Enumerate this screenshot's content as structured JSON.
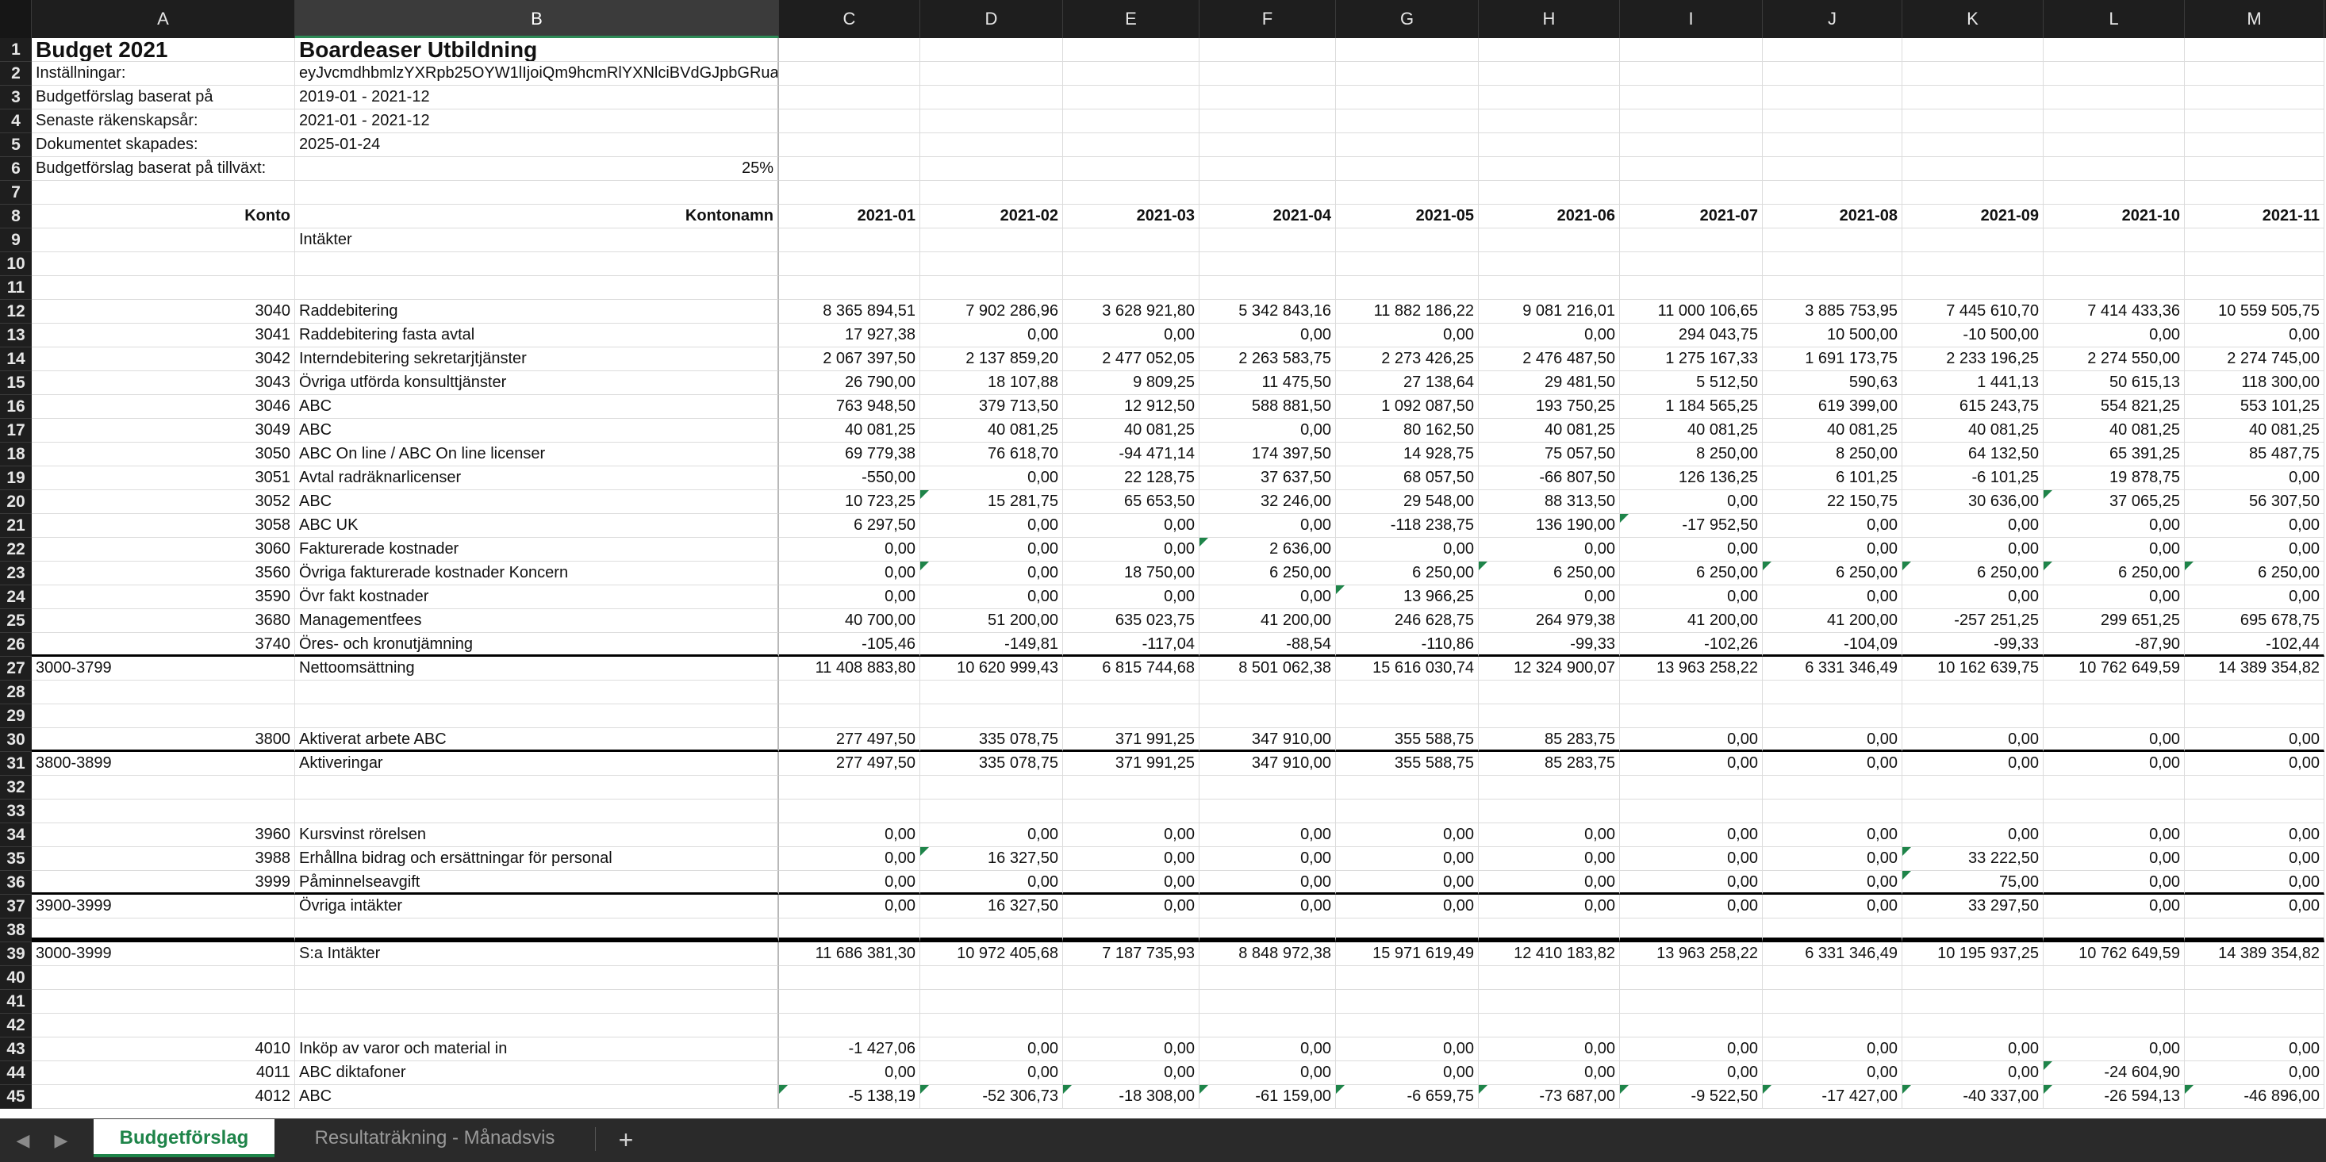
{
  "columns": [
    "A",
    "B",
    "C",
    "D",
    "E",
    "F",
    "G",
    "H",
    "I",
    "J",
    "K",
    "L",
    "M"
  ],
  "selected_column": "B",
  "rows": [
    {
      "n": 1,
      "a": "Budget 2021",
      "b": "Boardeaser Utbildning",
      "style": "title"
    },
    {
      "n": 2,
      "a": "Inställningar:",
      "b": "eyJvcmdhbmlzYXRpb25OYW1lIjoiQm9hcmRlYXNlciBVdGJpbGRuaW"
    },
    {
      "n": 3,
      "a": "Budgetförslag baserat på",
      "b": "2019-01 - 2021-12"
    },
    {
      "n": 4,
      "a": "Senaste räkenskapsår:",
      "b": "2021-01 - 2021-12"
    },
    {
      "n": 5,
      "a": "Dokumentet skapades:",
      "b": "2025-01-24"
    },
    {
      "n": 6,
      "a": "Budgetförslag baserat på tillväxt:",
      "b": "25%",
      "b_align": "right"
    },
    {
      "n": 7
    },
    {
      "n": 8,
      "a": "Konto",
      "b": "Kontonamn",
      "v": [
        "2021-01",
        "2021-02",
        "2021-03",
        "2021-04",
        "2021-05",
        "2021-06",
        "2021-07",
        "2021-08",
        "2021-09",
        "2021-10",
        "2021-11"
      ],
      "style": "header"
    },
    {
      "n": 9,
      "b": "Intäkter"
    },
    {
      "n": 10
    },
    {
      "n": 11
    },
    {
      "n": 12,
      "a": "3040",
      "b": "Raddebitering",
      "v": [
        "8 365 894,51",
        "7 902 286,96",
        "3 628 921,80",
        "5 342 843,16",
        "11 882 186,22",
        "9 081 216,01",
        "11 000 106,65",
        "3 885 753,95",
        "7 445 610,70",
        "7 414 433,36",
        "10 559 505,75"
      ]
    },
    {
      "n": 13,
      "a": "3041",
      "b": "Raddebitering fasta avtal",
      "v": [
        "17 927,38",
        "0,00",
        "0,00",
        "0,00",
        "0,00",
        "0,00",
        "294 043,75",
        "10 500,00",
        "-10 500,00",
        "0,00",
        "0,00"
      ]
    },
    {
      "n": 14,
      "a": "3042",
      "b": "Interndebitering sekretarjtjänster",
      "v": [
        "2 067 397,50",
        "2 137 859,20",
        "2 477 052,05",
        "2 263 583,75",
        "2 273 426,25",
        "2 476 487,50",
        "1 275 167,33",
        "1 691 173,75",
        "2 233 196,25",
        "2 274 550,00",
        "2 274 745,00"
      ]
    },
    {
      "n": 15,
      "a": "3043",
      "b": "Övriga utförda konsulttjänster",
      "v": [
        "26 790,00",
        "18 107,88",
        "9 809,25",
        "11 475,50",
        "27 138,64",
        "29 481,50",
        "5 512,50",
        "590,63",
        "1 441,13",
        "50 615,13",
        "118 300,00"
      ]
    },
    {
      "n": 16,
      "a": "3046",
      "b": "ABC",
      "v": [
        "763 948,50",
        "379 713,50",
        "12 912,50",
        "588 881,50",
        "1 092 087,50",
        "193 750,25",
        "1 184 565,25",
        "619 399,00",
        "615 243,75",
        "554 821,25",
        "553 101,25"
      ]
    },
    {
      "n": 17,
      "a": "3049",
      "b": "ABC",
      "v": [
        "40 081,25",
        "40 081,25",
        "40 081,25",
        "0,00",
        "80 162,50",
        "40 081,25",
        "40 081,25",
        "40 081,25",
        "40 081,25",
        "40 081,25",
        "40 081,25"
      ]
    },
    {
      "n": 18,
      "a": "3050",
      "b": "ABC On line / ABC On line licenser",
      "v": [
        "69 779,38",
        "76 618,70",
        "-94 471,14",
        "174 397,50",
        "14 928,75",
        "75 057,50",
        "8 250,00",
        "8 250,00",
        "64 132,50",
        "65 391,25",
        "85 487,75"
      ]
    },
    {
      "n": 19,
      "a": "3051",
      "b": "Avtal radräknarlicenser",
      "v": [
        "-550,00",
        "0,00",
        "22 128,75",
        "37 637,50",
        "68 057,50",
        "-66 807,50",
        "126 136,25",
        "6 101,25",
        "-6 101,25",
        "19 878,75",
        "0,00"
      ]
    },
    {
      "n": 20,
      "a": "3052",
      "b": "ABC",
      "v": [
        "10 723,25",
        "15 281,75",
        "65 653,50",
        "32 246,00",
        "29 548,00",
        "88 313,50",
        "0,00",
        "22 150,75",
        "30 636,00",
        "37 065,25",
        "56 307,50"
      ]
    },
    {
      "n": 21,
      "a": "3058",
      "b": "ABC UK",
      "v": [
        "6 297,50",
        "0,00",
        "0,00",
        "0,00",
        "-118 238,75",
        "136 190,00",
        "-17 952,50",
        "0,00",
        "0,00",
        "0,00",
        "0,00"
      ]
    },
    {
      "n": 22,
      "a": "3060",
      "b": "Fakturerade kostnader",
      "v": [
        "0,00",
        "0,00",
        "0,00",
        "2 636,00",
        "0,00",
        "0,00",
        "0,00",
        "0,00",
        "0,00",
        "0,00",
        "0,00"
      ]
    },
    {
      "n": 23,
      "a": "3560",
      "b": "Övriga fakturerade kostnader Koncern",
      "v": [
        "0,00",
        "0,00",
        "18 750,00",
        "6 250,00",
        "6 250,00",
        "6 250,00",
        "6 250,00",
        "6 250,00",
        "6 250,00",
        "6 250,00",
        "6 250,00"
      ]
    },
    {
      "n": 24,
      "a": "3590",
      "b": "Övr fakt kostnader",
      "v": [
        "0,00",
        "0,00",
        "0,00",
        "0,00",
        "13 966,25",
        "0,00",
        "0,00",
        "0,00",
        "0,00",
        "0,00",
        "0,00"
      ]
    },
    {
      "n": 25,
      "a": "3680",
      "b": "Managementfees",
      "v": [
        "40 700,00",
        "51 200,00",
        "635 023,75",
        "41 200,00",
        "246 628,75",
        "264 979,38",
        "41 200,00",
        "41 200,00",
        "-257 251,25",
        "299 651,25",
        "695 678,75"
      ]
    },
    {
      "n": 26,
      "a": "3740",
      "b": "Öres- och kronutjämning",
      "v": [
        "-105,46",
        "-149,81",
        "-117,04",
        "-88,54",
        "-110,86",
        "-99,33",
        "-102,26",
        "-104,09",
        "-99,33",
        "-87,90",
        "-102,44"
      ],
      "style": "border"
    },
    {
      "n": 27,
      "a": "3000-3799",
      "b": "Nettoomsättning",
      "v": [
        "11 408 883,80",
        "10 620 999,43",
        "6 815 744,68",
        "8 501 062,38",
        "15 616 030,74",
        "12 324 900,07",
        "13 963 258,22",
        "6 331 346,49",
        "10 162 639,75",
        "10 762 649,59",
        "14 389 354,82"
      ],
      "a_align": "left"
    },
    {
      "n": 28
    },
    {
      "n": 29
    },
    {
      "n": 30,
      "a": "3800",
      "b": "Aktiverat arbete ABC",
      "v": [
        "277 497,50",
        "335 078,75",
        "371 991,25",
        "347 910,00",
        "355 588,75",
        "85 283,75",
        "0,00",
        "0,00",
        "0,00",
        "0,00",
        "0,00"
      ],
      "style": "border"
    },
    {
      "n": 31,
      "a": "3800-3899",
      "b": "Aktiveringar",
      "v": [
        "277 497,50",
        "335 078,75",
        "371 991,25",
        "347 910,00",
        "355 588,75",
        "85 283,75",
        "0,00",
        "0,00",
        "0,00",
        "0,00",
        "0,00"
      ],
      "a_align": "left"
    },
    {
      "n": 32
    },
    {
      "n": 33
    },
    {
      "n": 34,
      "a": "3960",
      "b": "Kursvinst rörelsen",
      "v": [
        "0,00",
        "0,00",
        "0,00",
        "0,00",
        "0,00",
        "0,00",
        "0,00",
        "0,00",
        "0,00",
        "0,00",
        "0,00"
      ]
    },
    {
      "n": 35,
      "a": "3988",
      "b": "Erhållna bidrag och ersättningar för personal",
      "v": [
        "0,00",
        "16 327,50",
        "0,00",
        "0,00",
        "0,00",
        "0,00",
        "0,00",
        "0,00",
        "33 222,50",
        "0,00",
        "0,00"
      ]
    },
    {
      "n": 36,
      "a": "3999",
      "b": "Påminnelseavgift",
      "v": [
        "0,00",
        "0,00",
        "0,00",
        "0,00",
        "0,00",
        "0,00",
        "0,00",
        "0,00",
        "75,00",
        "0,00",
        "0,00"
      ],
      "style": "border"
    },
    {
      "n": 37,
      "a": "3900-3999",
      "b": "Övriga intäkter",
      "v": [
        "0,00",
        "16 327,50",
        "0,00",
        "0,00",
        "0,00",
        "0,00",
        "0,00",
        "0,00",
        "33 297,50",
        "0,00",
        "0,00"
      ],
      "a_align": "left"
    },
    {
      "n": 38,
      "style": "thick"
    },
    {
      "n": 39,
      "a": "3000-3999",
      "b": "S:a Intäkter",
      "v": [
        "11 686 381,30",
        "10 972 405,68",
        "7 187 735,93",
        "8 848 972,38",
        "15 971 619,49",
        "12 410 183,82",
        "13 963 258,22",
        "6 331 346,49",
        "10 195 937,25",
        "10 762 649,59",
        "14 389 354,82"
      ],
      "a_align": "left"
    },
    {
      "n": 40
    },
    {
      "n": 41
    },
    {
      "n": 42
    },
    {
      "n": 43,
      "a": "4010",
      "b": "Inköp av varor och material in",
      "v": [
        "-1 427,06",
        "0,00",
        "0,00",
        "0,00",
        "0,00",
        "0,00",
        "0,00",
        "0,00",
        "0,00",
        "0,00",
        "0,00"
      ]
    },
    {
      "n": 44,
      "a": "4011",
      "b": "ABC diktafoner",
      "v": [
        "0,00",
        "0,00",
        "0,00",
        "0,00",
        "0,00",
        "0,00",
        "0,00",
        "0,00",
        "0,00",
        "-24 604,90",
        "0,00"
      ]
    },
    {
      "n": 45,
      "a": "4012",
      "b": "ABC",
      "v": [
        "-5 138,19",
        "-52 306,73",
        "-18 308,00",
        "-61 159,00",
        "-6 659,75",
        "-73 687,00",
        "-9 522,50",
        "-17 427,00",
        "-40 337,00",
        "-26 594,13",
        "-46 896,00"
      ]
    }
  ],
  "comment_markers": [
    [
      20,
      "D"
    ],
    [
      21,
      "I"
    ],
    [
      22,
      "F"
    ],
    [
      23,
      "D"
    ],
    [
      23,
      "H"
    ],
    [
      23,
      "J"
    ],
    [
      23,
      "K"
    ],
    [
      23,
      "L"
    ],
    [
      23,
      "M"
    ],
    [
      24,
      "G"
    ],
    [
      35,
      "D"
    ],
    [
      35,
      "K"
    ],
    [
      36,
      "K"
    ],
    [
      20,
      "L"
    ],
    [
      44,
      "L"
    ],
    [
      45,
      "C"
    ],
    [
      45,
      "D"
    ],
    [
      45,
      "E"
    ],
    [
      45,
      "F"
    ],
    [
      45,
      "G"
    ],
    [
      45,
      "H"
    ],
    [
      45,
      "I"
    ],
    [
      45,
      "J"
    ],
    [
      45,
      "K"
    ],
    [
      45,
      "L"
    ],
    [
      45,
      "M"
    ]
  ],
  "tabs": [
    {
      "label": "Budgetförslag",
      "active": true
    },
    {
      "label": "Resultaträkning - Månadsvis",
      "active": false
    }
  ],
  "add_sheet_label": "+",
  "nav_prev": "◀",
  "nav_next": "▶"
}
